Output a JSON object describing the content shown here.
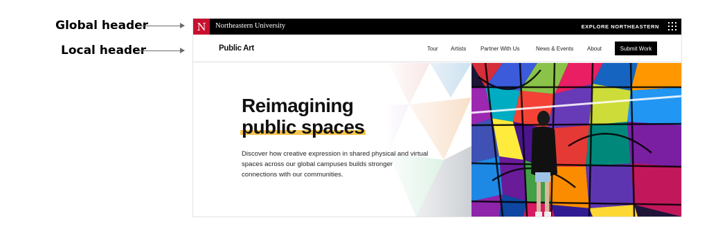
{
  "annotations": [
    {
      "label": "Global header"
    },
    {
      "label": "Local header"
    }
  ],
  "global_header": {
    "logo_letter": "N",
    "university_name": "Northeastern University",
    "explore_label": "EXPLORE NORTHEASTERN",
    "menu_icon": "grid-menu-icon",
    "brand_color": "#c8102e"
  },
  "local_header": {
    "site_title": "Public Art",
    "nav_items": [
      {
        "label": "Tour"
      },
      {
        "label": "Artists"
      },
      {
        "label": "Partner With Us"
      },
      {
        "label": "News & Events"
      },
      {
        "label": "About"
      }
    ],
    "cta_label": "Submit Work"
  },
  "hero": {
    "headline_line1": "Reimagining",
    "headline_line2": "public spaces",
    "highlight_color": "#f6c54e",
    "description": "Discover how creative expression in shared physical and virtual spaces across our global campuses builds stronger connections with our communities."
  }
}
